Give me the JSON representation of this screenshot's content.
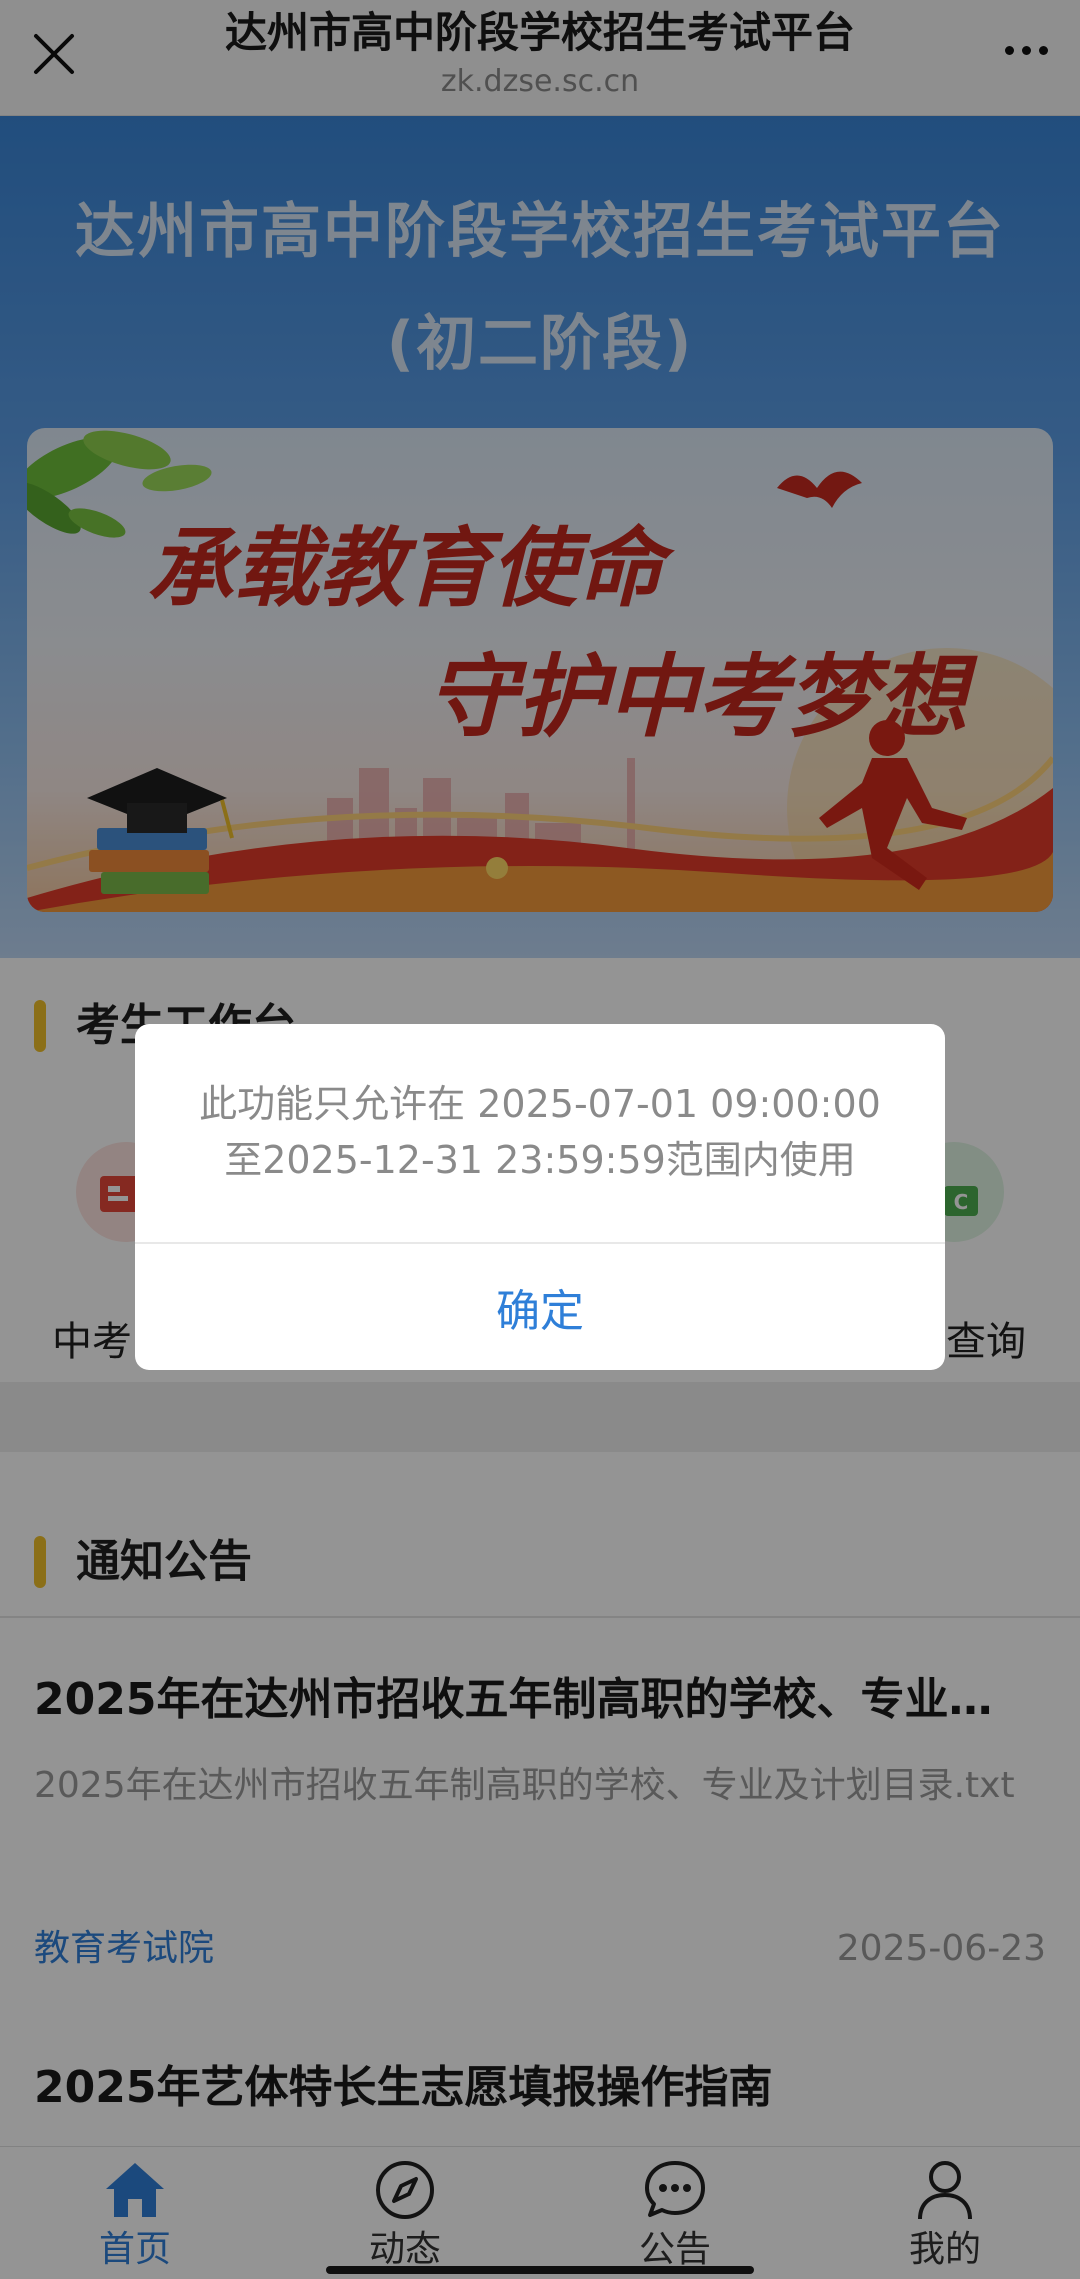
{
  "topbar": {
    "title": "达州市高中阶段学校招生考试平台",
    "url": "zk.dzse.sc.cn"
  },
  "hero": {
    "title_line1": "达州市高中阶段学校招生考试平台",
    "title_line2": "(初二阶段)",
    "banner_text_line1": "承载教育使命",
    "banner_text_line2": "守护中考梦想"
  },
  "workbench": {
    "section_title": "考生工作台",
    "items": [
      {
        "label": "中考",
        "icon": "document-icon"
      },
      {
        "label": "查询",
        "icon": "abc-blocks-icon"
      }
    ]
  },
  "notices": {
    "section_title": "通知公告",
    "items": [
      {
        "title": "2025年在达州市招收五年制高职的学校、专业…",
        "desc": "2025年在达州市招收五年制高职的学校、专业及计划目录.txt",
        "source": "教育考试院",
        "date": "2025-06-23"
      },
      {
        "title": "2025年艺体特长生志愿填报操作指南"
      }
    ]
  },
  "tabbar": {
    "items": [
      {
        "label": "首页",
        "icon": "home-icon",
        "active": true
      },
      {
        "label": "动态",
        "icon": "compass-icon",
        "active": false
      },
      {
        "label": "公告",
        "icon": "chat-bubble-icon",
        "active": false
      },
      {
        "label": "我的",
        "icon": "user-icon",
        "active": false
      }
    ]
  },
  "dialog": {
    "message": "此功能只允许在 2025-07-01 09:00:00至2025-12-31 23:59:59范围内使用",
    "confirm_label": "确定"
  },
  "colors": {
    "accent": "#2f7fd8",
    "section_bar": "#f0c02a",
    "hero_top": "#3a86d8"
  }
}
